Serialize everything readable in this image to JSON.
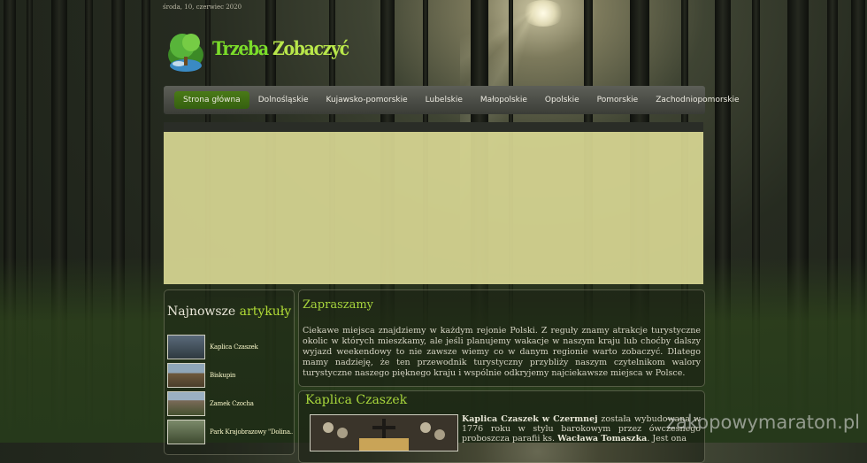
{
  "date_line": "środa, 10, czerwiec 2020",
  "logo": {
    "word1": "Trzeba",
    "word2": "Zobaczyć"
  },
  "nav": {
    "items": [
      {
        "label": "Strona główna",
        "active": true
      },
      {
        "label": "Dolnośląskie"
      },
      {
        "label": "Kujawsko-pomorskie"
      },
      {
        "label": "Lubelskie"
      },
      {
        "label": "Małopolskie"
      },
      {
        "label": "Opolskie"
      },
      {
        "label": "Pomorskie"
      },
      {
        "label": "Zachodniopomorskie"
      }
    ]
  },
  "sidebar": {
    "title_plain": "Najnowsze",
    "title_highlight": "artykuły",
    "items": [
      {
        "label": "Kaplica Czaszek"
      },
      {
        "label": "Biskupin"
      },
      {
        "label": "Zamek Czocha"
      },
      {
        "label": "Park Krajobrazowy \"Dolina..."
      }
    ]
  },
  "welcome": {
    "title": "Zapraszamy",
    "text": "Ciekawe miejsca znajdziemy w każdym rejonie Polski. Z reguły znamy atrakcje turystyczne okolic w których mieszkamy, ale jeśli planujemy wakacje w naszym kraju lub choćby dalszy wyjazd weekendowy to nie zawsze wiemy co w danym regionie warto zobaczyć. Dlatego mamy nadzieję, że ten przewodnik turystyczny przybliży naszym czytelnikom walory turystyczne naszego pięknego kraju i wspólnie odkryjemy najciekawsze miejsca w Polsce."
  },
  "article": {
    "title": "Kaplica Czaszek",
    "lead_bold": "Kaplica Czaszek w Czermnej",
    "text_1": " została wybudowana w 1776 roku w stylu barokowym przez ówczesnego proboszcza parafii ks. ",
    "text_bold_2": "Wacława Tomaszka",
    "text_2": ". Jest ona"
  },
  "watermark": "zakopowymaraton.pl",
  "colors": {
    "accent_green": "#a7d53c",
    "nav_active": "#4a7a17",
    "banner": "#d7d692"
  }
}
